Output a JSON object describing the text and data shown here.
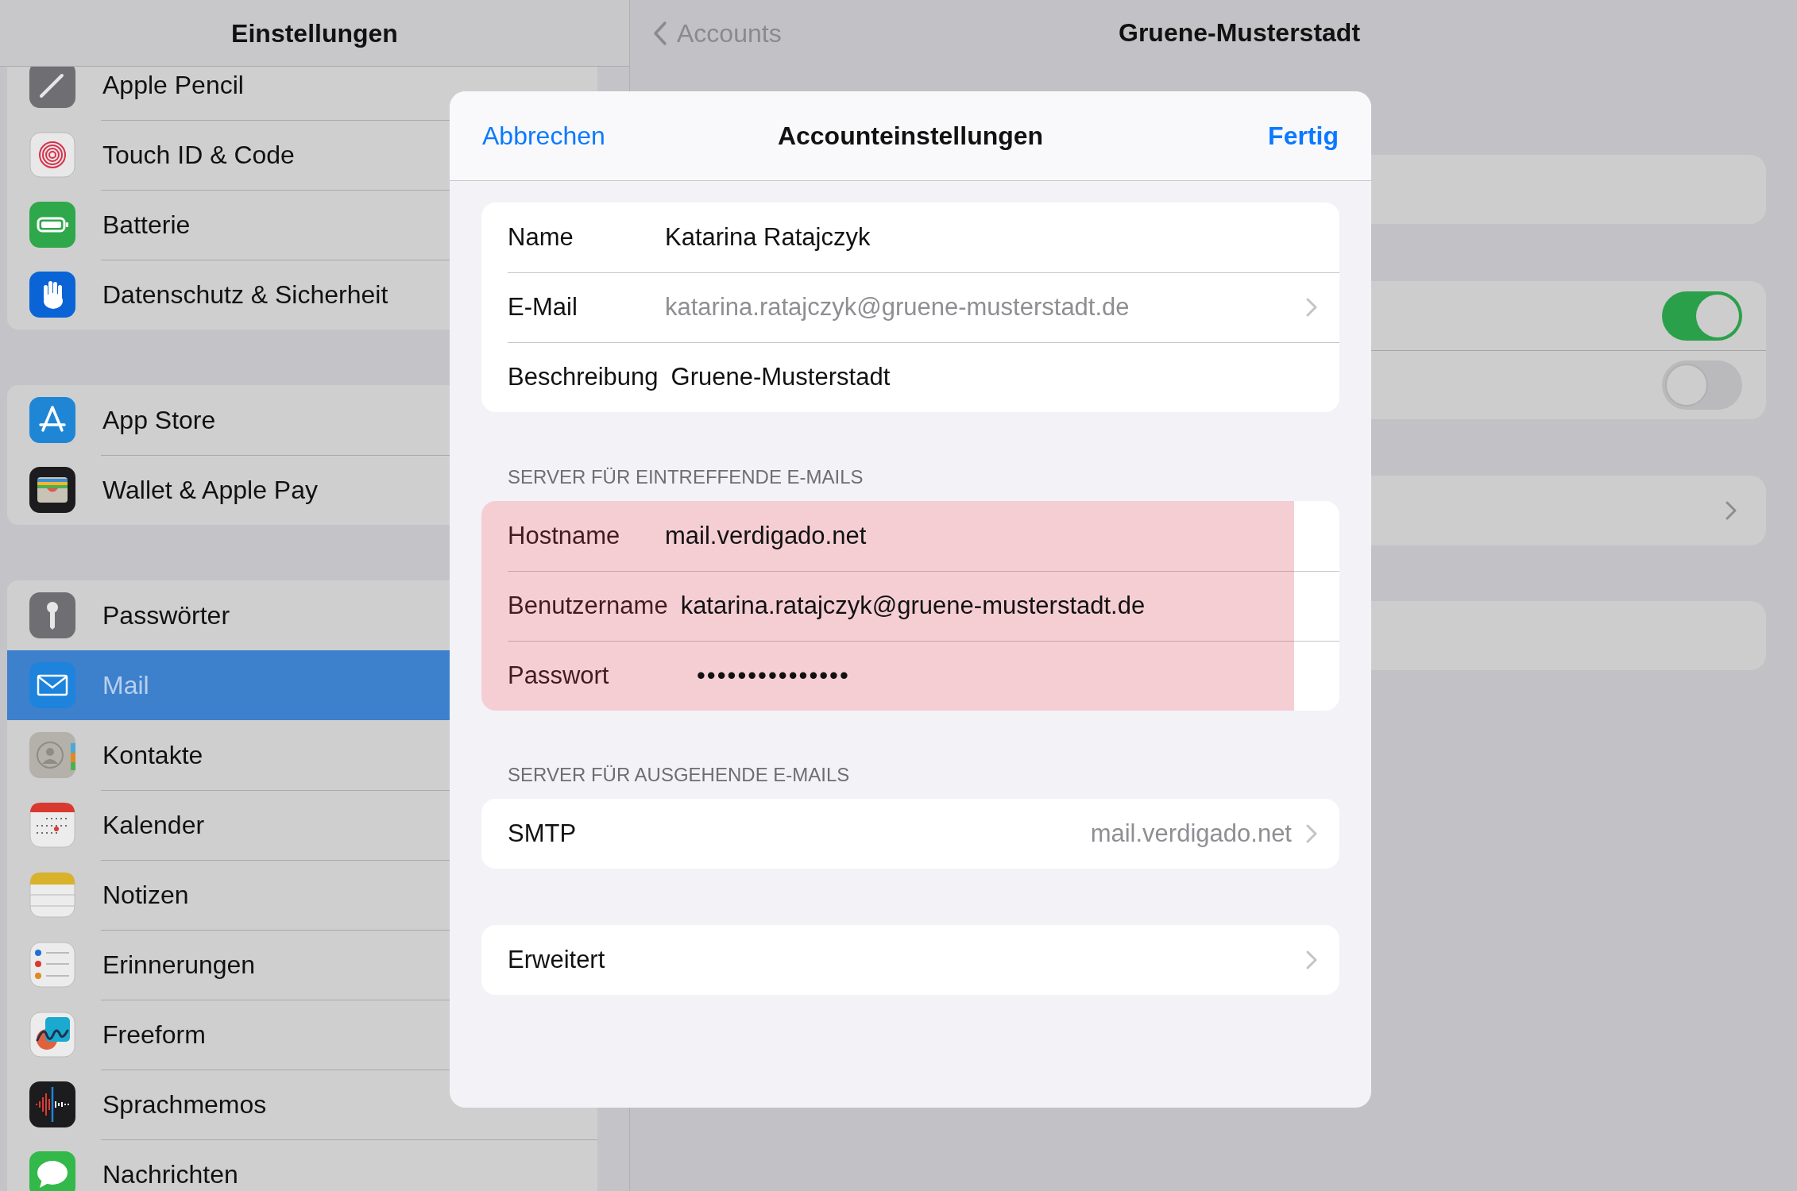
{
  "sidebar": {
    "title": "Einstellungen",
    "groups": [
      {
        "items": [
          {
            "label": "Apple Pencil",
            "selected": false
          },
          {
            "label": "Touch ID & Code",
            "selected": false
          },
          {
            "label": "Batterie",
            "selected": false
          },
          {
            "label": "Datenschutz & Sicherheit",
            "selected": false
          }
        ]
      },
      {
        "items": [
          {
            "label": "App Store",
            "selected": false
          },
          {
            "label": "Wallet & Apple Pay",
            "selected": false
          }
        ]
      },
      {
        "items": [
          {
            "label": "Passwörter",
            "selected": false
          },
          {
            "label": "Mail",
            "selected": true
          },
          {
            "label": "Kontakte",
            "selected": false
          },
          {
            "label": "Kalender",
            "selected": false
          },
          {
            "label": "Notizen",
            "selected": false
          },
          {
            "label": "Erinnerungen",
            "selected": false
          },
          {
            "label": "Freeform",
            "selected": false
          },
          {
            "label": "Sprachmemos",
            "selected": false
          },
          {
            "label": "Nachrichten",
            "selected": false
          }
        ]
      }
    ]
  },
  "detail": {
    "back": "Accounts",
    "title": "Gruene-Musterstadt",
    "cards": [
      {
        "kind": "blank"
      },
      {
        "kind": "toggles",
        "toggles": [
          {
            "on": true
          },
          {
            "on": false
          }
        ]
      },
      {
        "kind": "link"
      },
      {
        "kind": "blank"
      }
    ]
  },
  "sheet": {
    "cancel": "Abbrechen",
    "title": "Accounteinstellungen",
    "done": "Fertig",
    "sections": [
      {
        "highlighted": false,
        "rows": [
          {
            "kind": "field",
            "label": "Name",
            "value": "Katarina Ratajczyk"
          },
          {
            "kind": "link",
            "label": "E-Mail",
            "value": "katarina.ratajczyk@gruene-musterstadt.de"
          },
          {
            "kind": "field",
            "label": "Beschreibung",
            "value": "Gruene-Musterstadt"
          }
        ]
      },
      {
        "header": "SERVER FÜR EINTREFFENDE E-MAILS",
        "highlighted": true,
        "rows": [
          {
            "kind": "field",
            "label": "Hostname",
            "value": "mail.verdigado.net"
          },
          {
            "kind": "field",
            "label": "Benutzername",
            "value": "katarina.ratajczyk@gruene-musterstadt.de"
          },
          {
            "kind": "secure",
            "label": "Passwort",
            "value": "•••••••••••••••"
          }
        ]
      },
      {
        "header": "SERVER FÜR AUSGEHENDE E-MAILS",
        "highlighted": false,
        "rows": [
          {
            "kind": "detail",
            "label": "SMTP",
            "value": "mail.verdigado.net"
          }
        ]
      },
      {
        "highlighted": false,
        "rows": [
          {
            "kind": "nav",
            "label": "Erweitert"
          }
        ]
      }
    ]
  }
}
